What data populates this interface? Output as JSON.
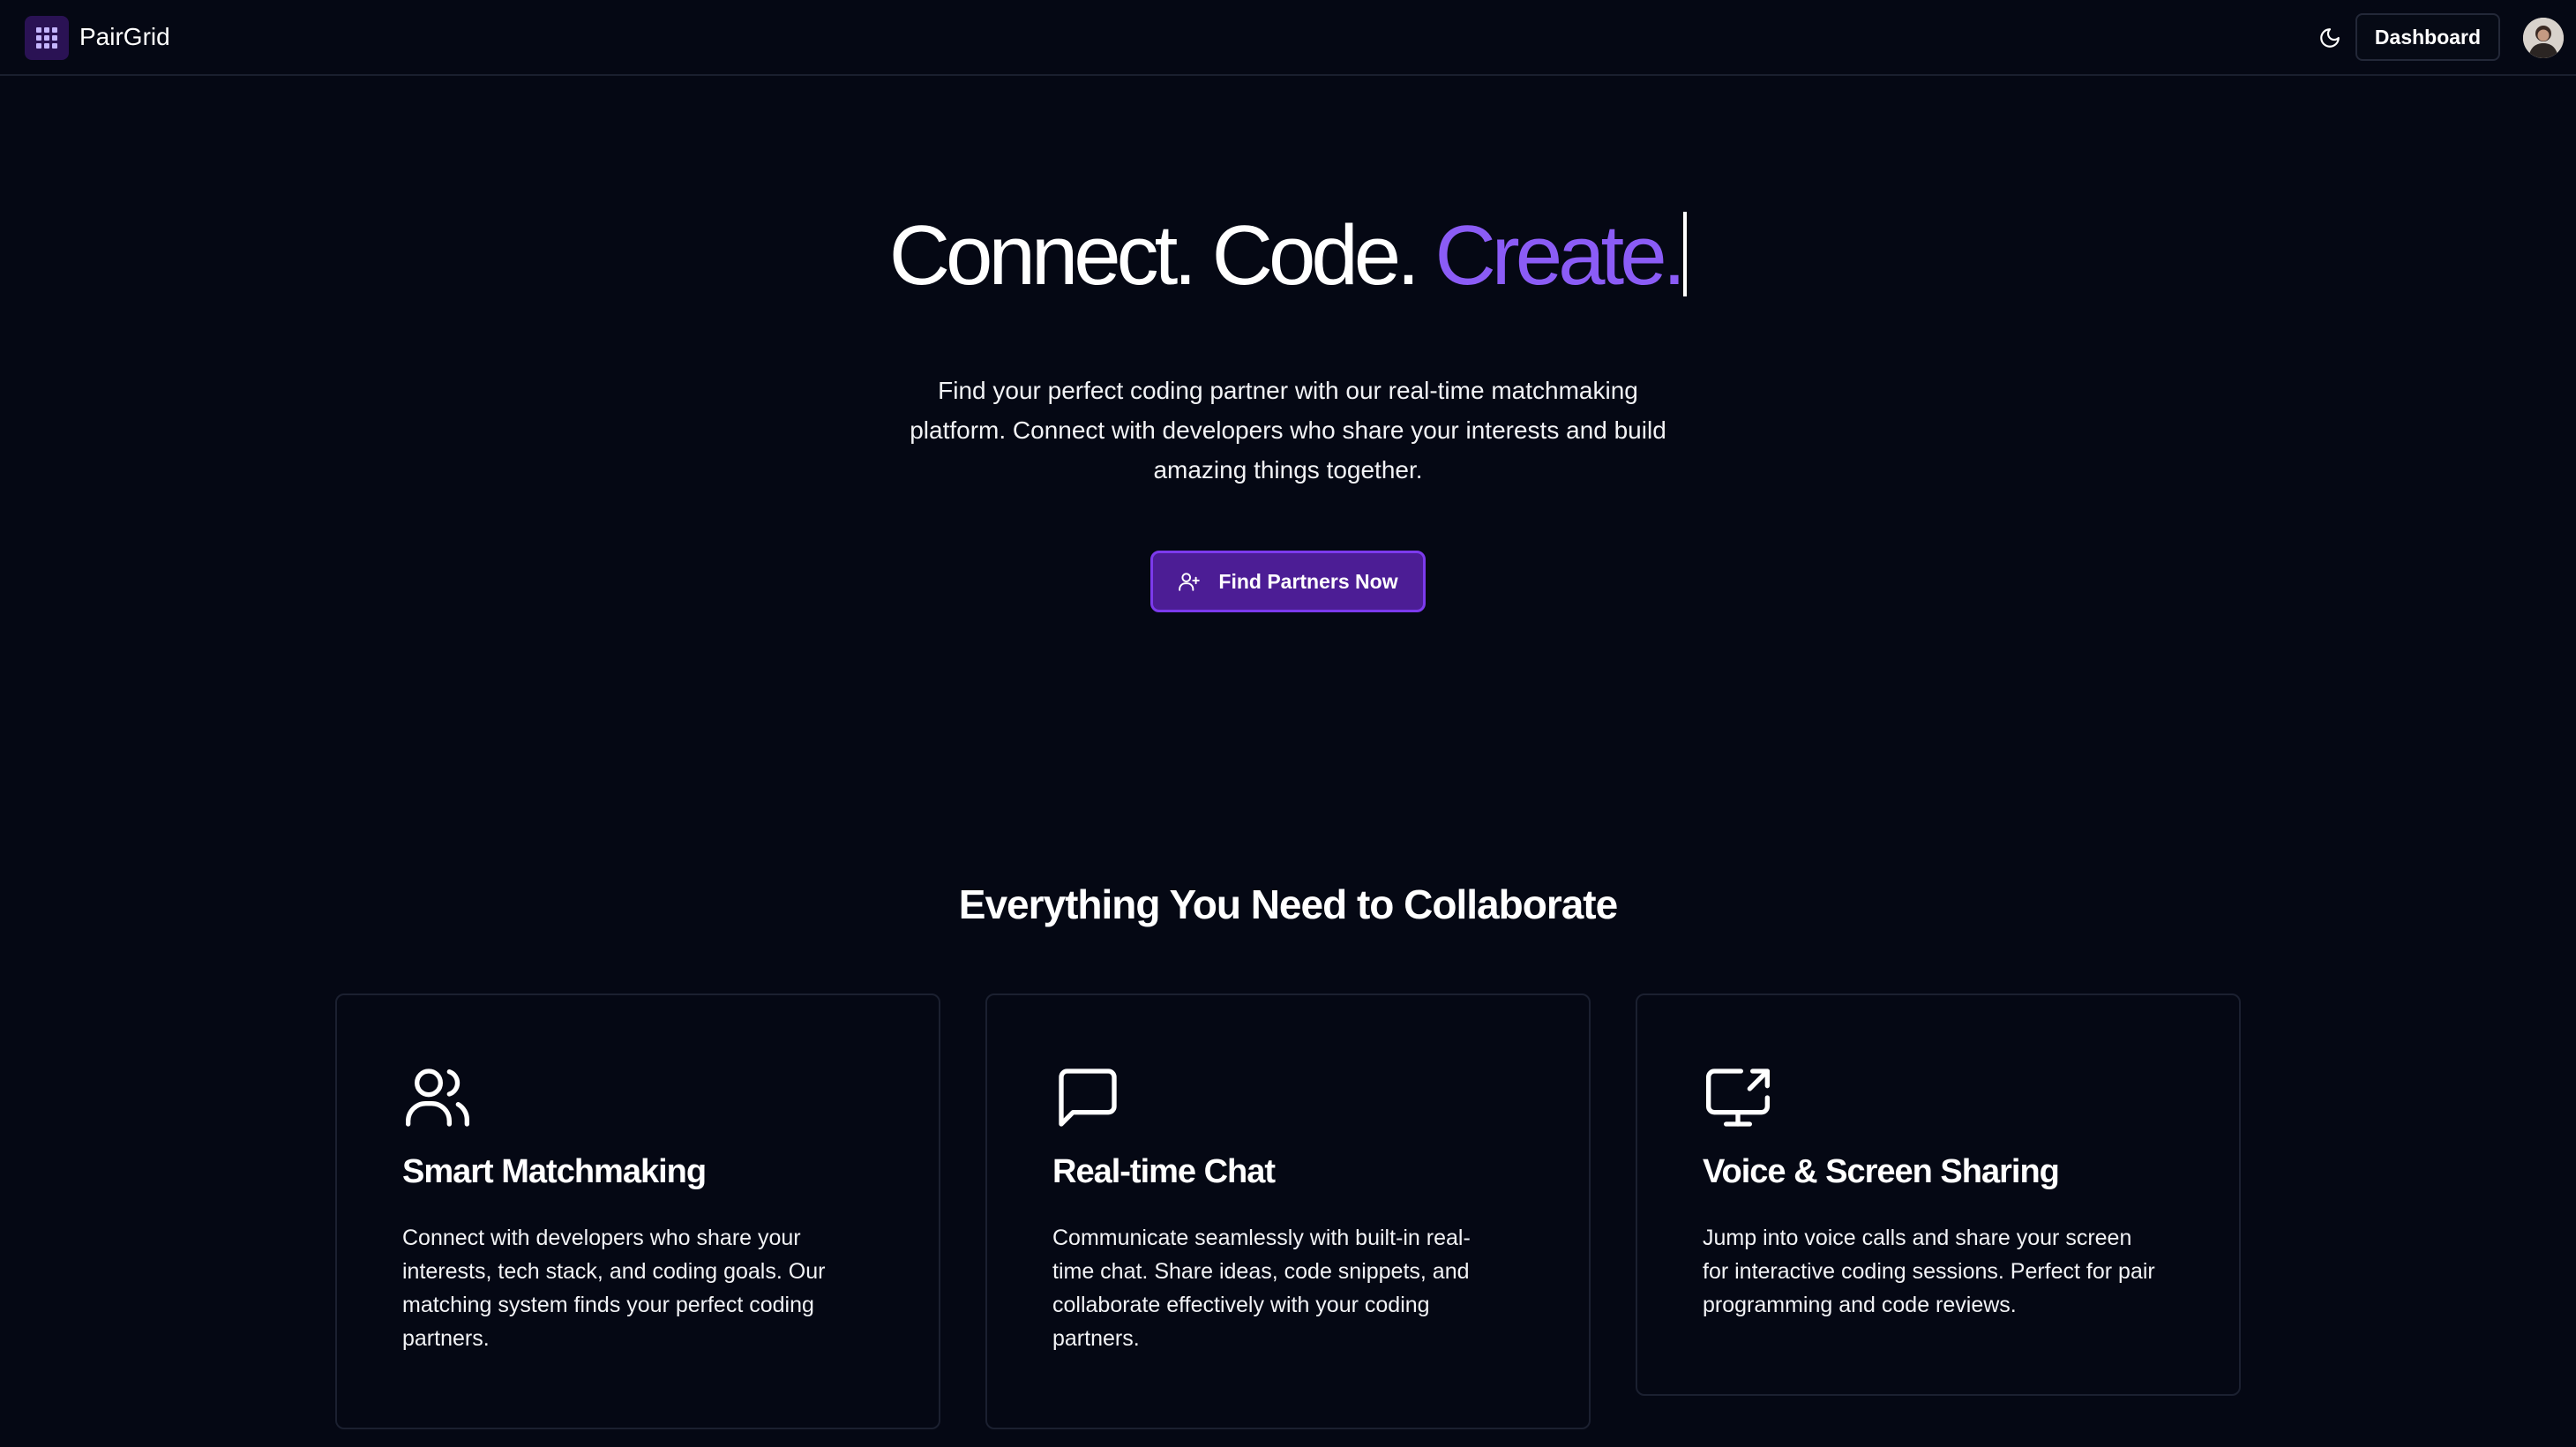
{
  "header": {
    "brand": "PairGrid",
    "dashboard_label": "Dashboard",
    "icons": {
      "logo": "grid-logo-icon",
      "theme": "moon-icon",
      "avatar": "user-avatar"
    },
    "logo_color": "#2a1254"
  },
  "hero": {
    "title_part1": "Connect. Code. ",
    "title_accent": "Create.",
    "subtitle": "Find your perfect coding partner with our real-time matchmaking platform. Connect with developers who share your interests and build amazing things together.",
    "cta_label": "Find Partners Now",
    "accent_color": "#8b5cf6"
  },
  "features": {
    "title": "Everything You Need to Collaborate",
    "cards": [
      {
        "icon": "users-icon",
        "title": "Smart Matchmaking",
        "description": "Connect with developers who share your interests, tech stack, and coding goals. Our matching system finds your perfect coding partners."
      },
      {
        "icon": "chat-icon",
        "title": "Real-time Chat",
        "description": "Communicate seamlessly with built-in real-time chat. Share ideas, code snippets, and collaborate effectively with your coding partners."
      },
      {
        "icon": "screen-share-icon",
        "title": "Voice & Screen Sharing",
        "description": "Jump into voice calls and share your screen for interactive coding sessions. Perfect for pair programming and code reviews."
      }
    ]
  }
}
